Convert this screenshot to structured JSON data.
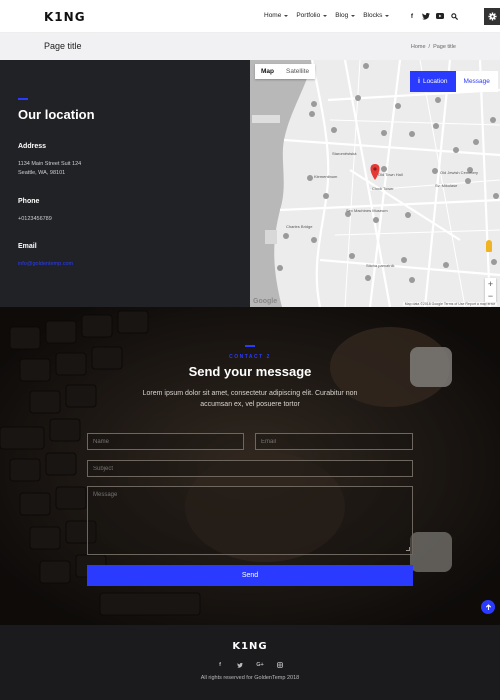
{
  "header": {
    "logo": "K1NG",
    "nav": [
      {
        "label": "Home"
      },
      {
        "label": "Portfolio"
      },
      {
        "label": "Blog"
      },
      {
        "label": "Blocks"
      }
    ],
    "social_icons": [
      "facebook-icon",
      "twitter-icon",
      "youtube-icon",
      "search-icon"
    ]
  },
  "titlebar": {
    "title": "Page title",
    "breadcrumb": [
      "Home",
      "Page title"
    ],
    "separator": "/"
  },
  "location": {
    "title": "Our location",
    "address_heading": "Address",
    "address_line1": "1134 Main Street Suit 124",
    "address_line2": "Seattle, WA, 98101",
    "phone_heading": "Phone",
    "phone": "+0123456789",
    "email_heading": "Email",
    "email": "info@goldentemp.com"
  },
  "map": {
    "tabs": [
      "Map",
      "Satellite"
    ],
    "active_tab": "Map",
    "location_button": "Location",
    "message_button": "Message",
    "place_labels": [
      "Staroměstská",
      "Klementinum",
      "Sex Machines Museum",
      "Charles Bridge",
      "Clock Tower",
      "Old Town Hall",
      "Sticha pamatnik",
      "Old Jewish Cemetery",
      "Sv. Mikulase"
    ],
    "zoom_in": "+",
    "zoom_out": "−",
    "google_logo": "Google",
    "attribution": "Map data ©2018 Google   Terms of Use   Report a map error"
  },
  "contact": {
    "kicker": "CONTACT 2",
    "title": "Send your message",
    "description": "Lorem ipsum dolor sit amet, consectetur adipiscing elit. Curabitur non accumsan ex, vel posuere tortor",
    "name_placeholder": "Name",
    "email_placeholder": "Email",
    "subject_placeholder": "Subject",
    "message_placeholder": "Message",
    "send_label": "Send"
  },
  "footer": {
    "logo": "K1NG",
    "social_icons": [
      "facebook-icon",
      "twitter-icon",
      "google-plus-icon",
      "instagram-icon"
    ],
    "copyright": "All rights reserved for GoldenTemp 2018"
  },
  "colors": {
    "accent": "#2a3bff",
    "dark_panel": "#212226",
    "footer": "#1b1b1d"
  }
}
